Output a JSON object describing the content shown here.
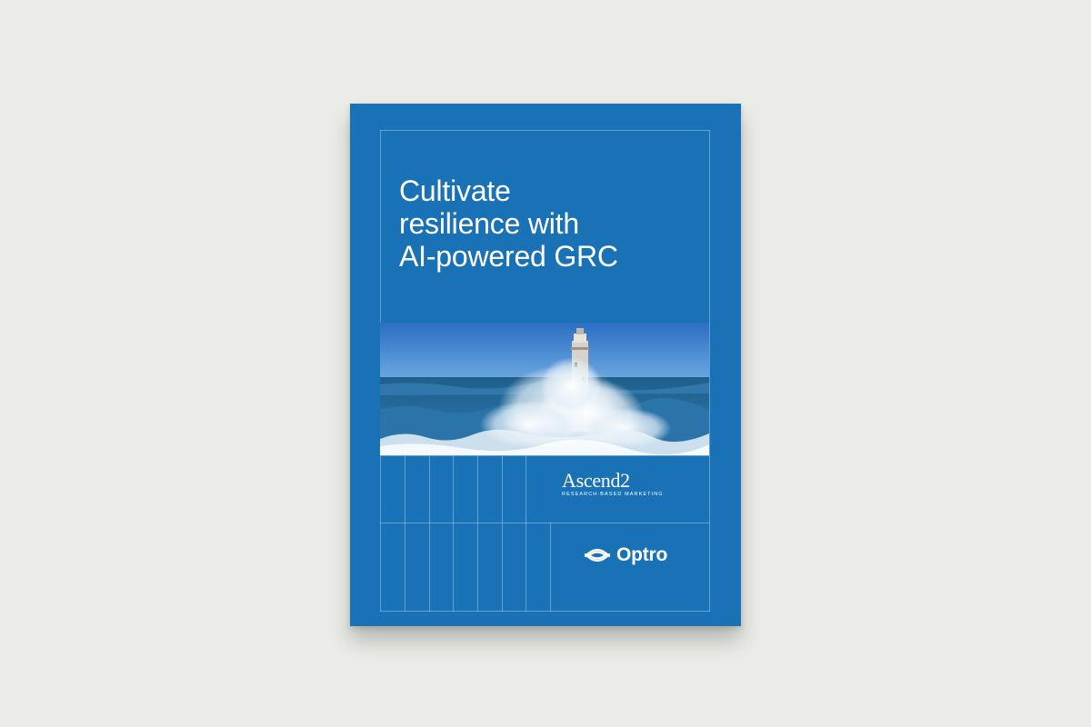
{
  "cover": {
    "background_color": "#1a72b6",
    "title_lines": [
      "Cultivate",
      "resilience with",
      "AI-powered GRC"
    ],
    "photo": {
      "subject": "lighthouse-in-crashing-waves"
    }
  },
  "logos": {
    "ascend": {
      "name": "Ascend2",
      "tagline": "RESEARCH-BASED MARKETING"
    },
    "optro": {
      "name": "Optro",
      "icon": "optro-swirl-icon"
    }
  }
}
